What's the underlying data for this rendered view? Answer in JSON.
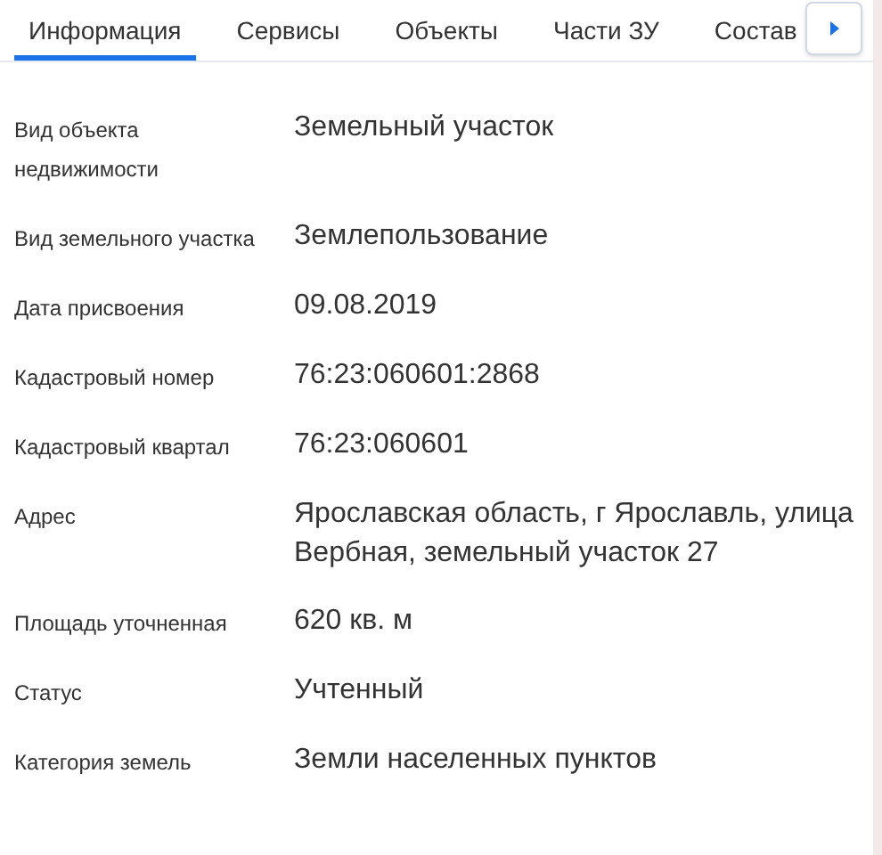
{
  "tabs": [
    {
      "label": "Информация",
      "selected": true
    },
    {
      "label": "Сервисы",
      "selected": false
    },
    {
      "label": "Объекты",
      "selected": false
    },
    {
      "label": "Части ЗУ",
      "selected": false
    },
    {
      "label": "Состав",
      "selected": false
    }
  ],
  "fields": [
    {
      "label": "Вид объекта недвижимости",
      "value": "Земельный участок"
    },
    {
      "label": "Вид земельного участка",
      "value": "Землепользование"
    },
    {
      "label": "Дата присвоения",
      "value": "09.08.2019"
    },
    {
      "label": "Кадастровый номер",
      "value": "76:23:060601:2868"
    },
    {
      "label": "Кадастровый квартал",
      "value": "76:23:060601"
    },
    {
      "label": "Адрес",
      "value": "Ярославская область, г Ярославль, улица Вербная, земельный участок 27"
    },
    {
      "label": "Площадь уточненная",
      "value": "620 кв. м"
    },
    {
      "label": "Статус",
      "value": "Учтенный"
    },
    {
      "label": "Категория земель",
      "value": "Земли населенных пунктов"
    }
  ]
}
